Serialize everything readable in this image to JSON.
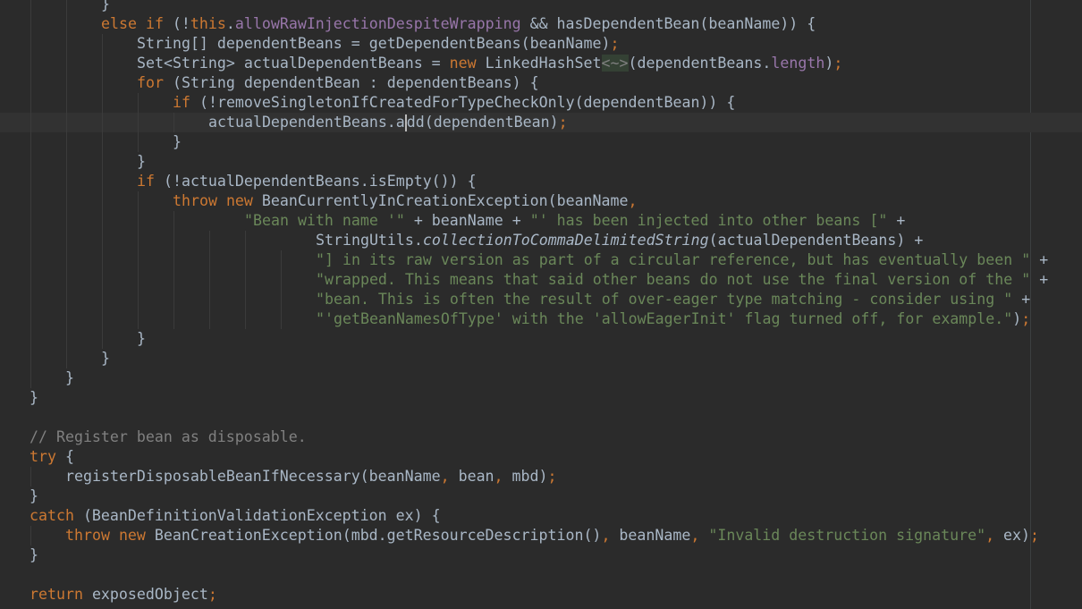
{
  "editor": {
    "lines": [
      {
        "level": 2,
        "indent": 2,
        "tokens": [
          {
            "text": "}",
            "c": "plain"
          }
        ]
      },
      {
        "level": 2,
        "indent": 2,
        "tokens": [
          {
            "text": "else if",
            "c": "kw"
          },
          {
            "text": " (!",
            "c": "plain"
          },
          {
            "text": "this",
            "c": "kw"
          },
          {
            "text": ".",
            "c": "plain"
          },
          {
            "text": "allowRawInjectionDespiteWrapping",
            "c": "field"
          },
          {
            "text": " && hasDependentBean(beanName)) {",
            "c": "plain"
          }
        ]
      },
      {
        "level": 3,
        "indent": 3,
        "tokens": [
          {
            "text": "String[] dependentBeans = getDependentBeans(beanName)",
            "c": "plain"
          },
          {
            "text": ";",
            "c": "semi"
          }
        ]
      },
      {
        "level": 3,
        "indent": 3,
        "tokens": [
          {
            "text": "Set<String> actualDependentBeans = ",
            "c": "plain"
          },
          {
            "text": "new",
            "c": "kw"
          },
          {
            "text": " LinkedHashSet",
            "c": "plain"
          },
          {
            "text": "<~>",
            "c": "diamond"
          },
          {
            "text": "(dependentBeans.",
            "c": "plain"
          },
          {
            "text": "length",
            "c": "field"
          },
          {
            "text": ")",
            "c": "plain"
          },
          {
            "text": ";",
            "c": "semi"
          }
        ]
      },
      {
        "level": 3,
        "indent": 3,
        "tokens": [
          {
            "text": "for",
            "c": "kw"
          },
          {
            "text": " (String dependentBean : dependentBeans) {",
            "c": "plain"
          }
        ]
      },
      {
        "level": 4,
        "indent": 4,
        "tokens": [
          {
            "text": "if",
            "c": "kw"
          },
          {
            "text": " (!removeSingletonIfCreatedForTypeCheckOnly(dependentBean)) {",
            "c": "plain"
          }
        ]
      },
      {
        "level": 5,
        "indent": 5,
        "current": true,
        "tokens": [
          {
            "text": "actualDependentBeans.a",
            "c": "plain"
          },
          {
            "caret": true
          },
          {
            "text": "dd(dependentBean)",
            "c": "plain"
          },
          {
            "text": ";",
            "c": "semi"
          }
        ]
      },
      {
        "level": 4,
        "indent": 4,
        "tokens": [
          {
            "text": "}",
            "c": "plain"
          }
        ]
      },
      {
        "level": 3,
        "indent": 3,
        "tokens": [
          {
            "text": "}",
            "c": "plain"
          }
        ]
      },
      {
        "level": 3,
        "indent": 3,
        "tokens": [
          {
            "text": "if",
            "c": "kw"
          },
          {
            "text": " (!actualDependentBeans.isEmpty()) {",
            "c": "plain"
          }
        ]
      },
      {
        "level": 4,
        "indent": 4,
        "tokens": [
          {
            "text": "throw new",
            "c": "kw"
          },
          {
            "text": " BeanCurrentlyInCreationException(beanName",
            "c": "plain"
          },
          {
            "text": ",",
            "c": "semi"
          }
        ]
      },
      {
        "level": 5,
        "indent": 6,
        "tokens": [
          {
            "text": "\"Bean with name '\"",
            "c": "str"
          },
          {
            "text": " + beanName + ",
            "c": "plain"
          },
          {
            "text": "\"' has been injected into other beans [\"",
            "c": "str"
          },
          {
            "text": " +",
            "c": "plain"
          }
        ]
      },
      {
        "level": 7,
        "indent": 8,
        "tokens": [
          {
            "text": "StringUtils.",
            "c": "plain"
          },
          {
            "text": "collectionToCommaDelimitedString",
            "c": "it"
          },
          {
            "text": "(actualDependentBeans) +",
            "c": "plain"
          }
        ]
      },
      {
        "level": 8,
        "indent": 8,
        "tokens": [
          {
            "text": "\"] in its raw version as part of a circular reference, but has eventually been \"",
            "c": "str"
          },
          {
            "text": " +",
            "c": "plain"
          }
        ]
      },
      {
        "level": 8,
        "indent": 8,
        "tokens": [
          {
            "text": "\"wrapped. This means that said other beans do not use the final version of the \"",
            "c": "str"
          },
          {
            "text": " +",
            "c": "plain"
          }
        ]
      },
      {
        "level": 8,
        "indent": 8,
        "tokens": [
          {
            "text": "\"bean. This is often the result of over-eager type matching - consider using \"",
            "c": "str"
          },
          {
            "text": " +",
            "c": "plain"
          }
        ]
      },
      {
        "level": 8,
        "indent": 8,
        "tokens": [
          {
            "text": "\"'getBeanNamesOfType' with the 'allowEagerInit' flag turned off, for example.\"",
            "c": "str"
          },
          {
            "text": ")",
            "c": "plain"
          },
          {
            "text": ";",
            "c": "semi"
          }
        ]
      },
      {
        "level": 3,
        "indent": 3,
        "tokens": [
          {
            "text": "}",
            "c": "plain"
          }
        ]
      },
      {
        "level": 2,
        "indent": 2,
        "tokens": [
          {
            "text": "}",
            "c": "plain"
          }
        ]
      },
      {
        "level": 1,
        "indent": 1,
        "tokens": [
          {
            "text": "}",
            "c": "plain"
          }
        ]
      },
      {
        "level": 0,
        "indent": 0,
        "tokens": [
          {
            "text": "}",
            "c": "plain"
          }
        ]
      },
      {
        "level": 0,
        "indent": 0,
        "tokens": []
      },
      {
        "level": 0,
        "indent": 0,
        "tokens": [
          {
            "text": "// Register bean as disposable.",
            "c": "com"
          }
        ]
      },
      {
        "level": 0,
        "indent": 0,
        "tokens": [
          {
            "text": "try",
            "c": "kw"
          },
          {
            "text": " {",
            "c": "plain"
          }
        ]
      },
      {
        "level": 1,
        "indent": 1,
        "tokens": [
          {
            "text": "registerDisposableBeanIfNecessary(beanName",
            "c": "plain"
          },
          {
            "text": ",",
            "c": "semi"
          },
          {
            "text": " bean",
            "c": "plain"
          },
          {
            "text": ",",
            "c": "semi"
          },
          {
            "text": " mbd)",
            "c": "plain"
          },
          {
            "text": ";",
            "c": "semi"
          }
        ]
      },
      {
        "level": 0,
        "indent": 0,
        "tokens": [
          {
            "text": "}",
            "c": "plain"
          }
        ]
      },
      {
        "level": 0,
        "indent": 0,
        "tokens": [
          {
            "text": "catch",
            "c": "kw"
          },
          {
            "text": " (BeanDefinitionValidationException ex) {",
            "c": "plain"
          }
        ]
      },
      {
        "level": 1,
        "indent": 1,
        "tokens": [
          {
            "text": "throw new",
            "c": "kw"
          },
          {
            "text": " BeanCreationException(mbd.getResourceDescription()",
            "c": "plain"
          },
          {
            "text": ",",
            "c": "semi"
          },
          {
            "text": " beanName",
            "c": "plain"
          },
          {
            "text": ",",
            "c": "semi"
          },
          {
            "text": " ",
            "c": "plain"
          },
          {
            "text": "\"Invalid destruction signature\"",
            "c": "str"
          },
          {
            "text": ",",
            "c": "semi"
          },
          {
            "text": " ex)",
            "c": "plain"
          },
          {
            "text": ";",
            "c": "semi"
          }
        ]
      },
      {
        "level": 0,
        "indent": 0,
        "tokens": [
          {
            "text": "}",
            "c": "plain"
          }
        ]
      },
      {
        "level": 0,
        "indent": 0,
        "tokens": []
      },
      {
        "level": 0,
        "indent": 0,
        "tokens": [
          {
            "text": "return",
            "c": "kw"
          },
          {
            "text": " exposedObject",
            "c": "plain"
          },
          {
            "text": ";",
            "c": "semi"
          }
        ]
      }
    ]
  }
}
